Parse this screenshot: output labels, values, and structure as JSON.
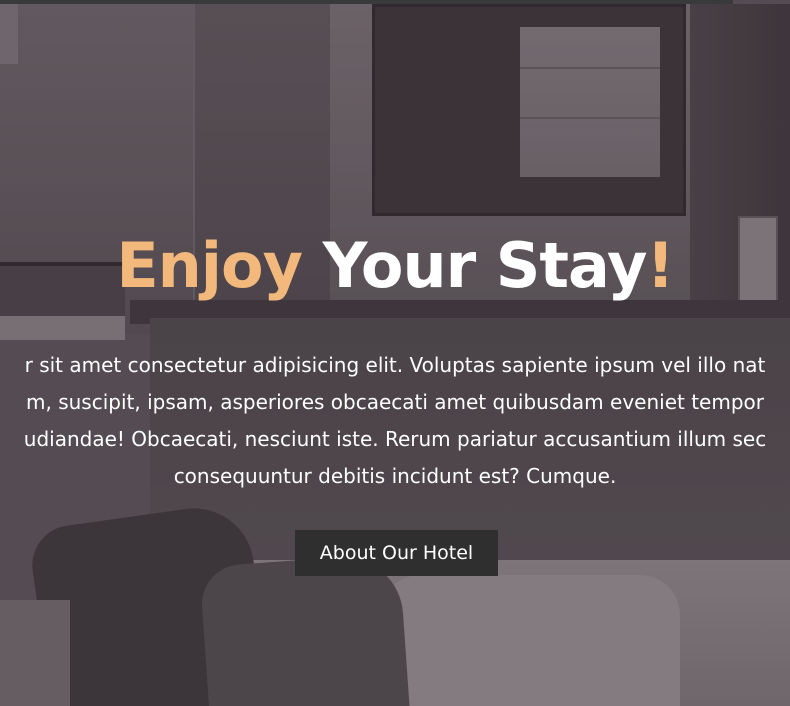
{
  "hero": {
    "title_accent": "Enjoy",
    "title_rest": " Your Stay",
    "title_exclaim": "!",
    "lead_lines": [
      "r sit amet consectetur adipisicing elit. Voluptas sapiente ipsum vel illo nat",
      "m, suscipit, ipsam, asperiores obcaecati amet quibusdam eveniet tempor",
      "udiandae! Obcaecati, nesciunt iste. Rerum pariatur accusantium illum sec",
      "consequuntur debitis incidunt est? Cumque."
    ],
    "button_label": "About Our Hotel"
  },
  "colors": {
    "accent": "#f3b87b",
    "button_bg": "#2f2f2f",
    "text": "#ffffff"
  }
}
